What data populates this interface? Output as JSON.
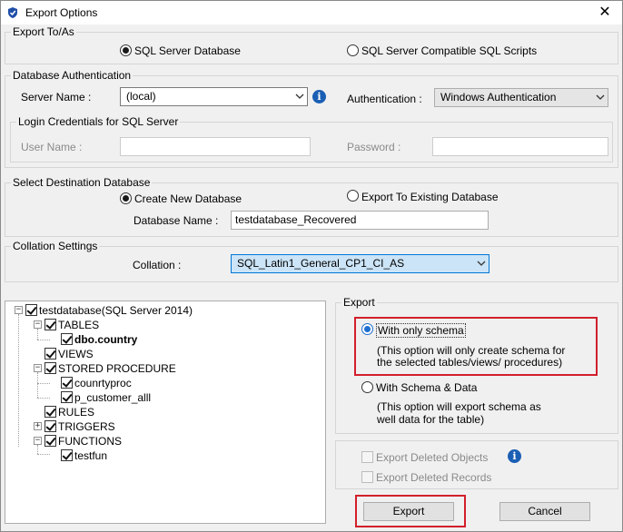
{
  "window": {
    "title": "Export Options",
    "close_glyph": "✕",
    "icon": "shield-app-icon"
  },
  "export_to": {
    "legend": "Export To/As",
    "options": [
      {
        "label": "SQL Server Database",
        "selected": true
      },
      {
        "label": "SQL Server Compatible SQL Scripts",
        "selected": false
      }
    ]
  },
  "db_auth": {
    "legend": "Database Authentication",
    "server_name_label": "Server Name :",
    "server_name_value": "(local)",
    "authentication_label": "Authentication :",
    "authentication_value": "Windows Authentication",
    "login": {
      "legend": "Login Credentials for SQL Server",
      "user_label": "User Name :",
      "password_label": "Password :",
      "user_value": "",
      "password_value": ""
    }
  },
  "destination": {
    "legend": "Select Destination Database",
    "options": [
      {
        "label": "Create New Database",
        "selected": true
      },
      {
        "label": "Export To Existing Database",
        "selected": false
      }
    ],
    "db_name_label": "Database Name :",
    "db_name_value": "testdatabase_Recovered"
  },
  "collation": {
    "legend": "Collation Settings",
    "label": "Collation :",
    "value": "SQL_Latin1_General_CP1_CI_AS"
  },
  "tree": {
    "root": "testdatabase(SQL Server 2014)",
    "tables": "TABLES",
    "table_item": "dbo.country",
    "views": "VIEWS",
    "procs": "STORED PROCEDURE",
    "proc_items": [
      "counrtyproc",
      "p_customer_alll"
    ],
    "rules": "RULES",
    "triggers": "TRIGGERS",
    "functions": "FUNCTIONS",
    "function_item": "testfun"
  },
  "export_panel": {
    "legend": "Export",
    "schema_only_label": "With only schema",
    "schema_only_desc_1": "(This option will only create schema for",
    "schema_only_desc_2": "the  selected tables/views/ procedures)",
    "schema_data_label": "With Schema & Data",
    "schema_data_desc_1": "(This option will export schema as",
    "schema_data_desc_2": "well data for the table)",
    "selected": "schema_only"
  },
  "deleted": {
    "objects_label": "Export Deleted Objects",
    "records_label": "Export Deleted Records"
  },
  "buttons": {
    "export": "Export",
    "cancel": "Cancel"
  },
  "colors": {
    "highlight": "#d21f2b",
    "selection": "#cce4f7",
    "info": "#1a5fb4"
  }
}
